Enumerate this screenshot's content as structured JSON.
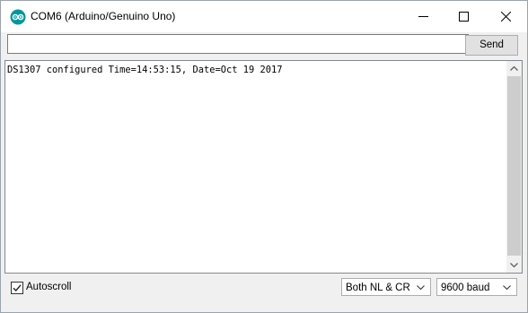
{
  "window": {
    "title": "COM6 (Arduino/Genuino Uno)",
    "brand_color": "#00979c",
    "icons": [
      "arduino-logo-icon",
      "minimize-icon",
      "maximize-icon",
      "close-icon"
    ]
  },
  "send_bar": {
    "input_value": "",
    "send_label": "Send"
  },
  "output": {
    "lines": [
      "DS1307 configured Time=14:53:15, Date=Oct 19 2017"
    ]
  },
  "footer": {
    "autoscroll_label": "Autoscroll",
    "autoscroll_checked": true,
    "line_ending": "Both NL & CR",
    "baud_rate": "9600 baud"
  }
}
